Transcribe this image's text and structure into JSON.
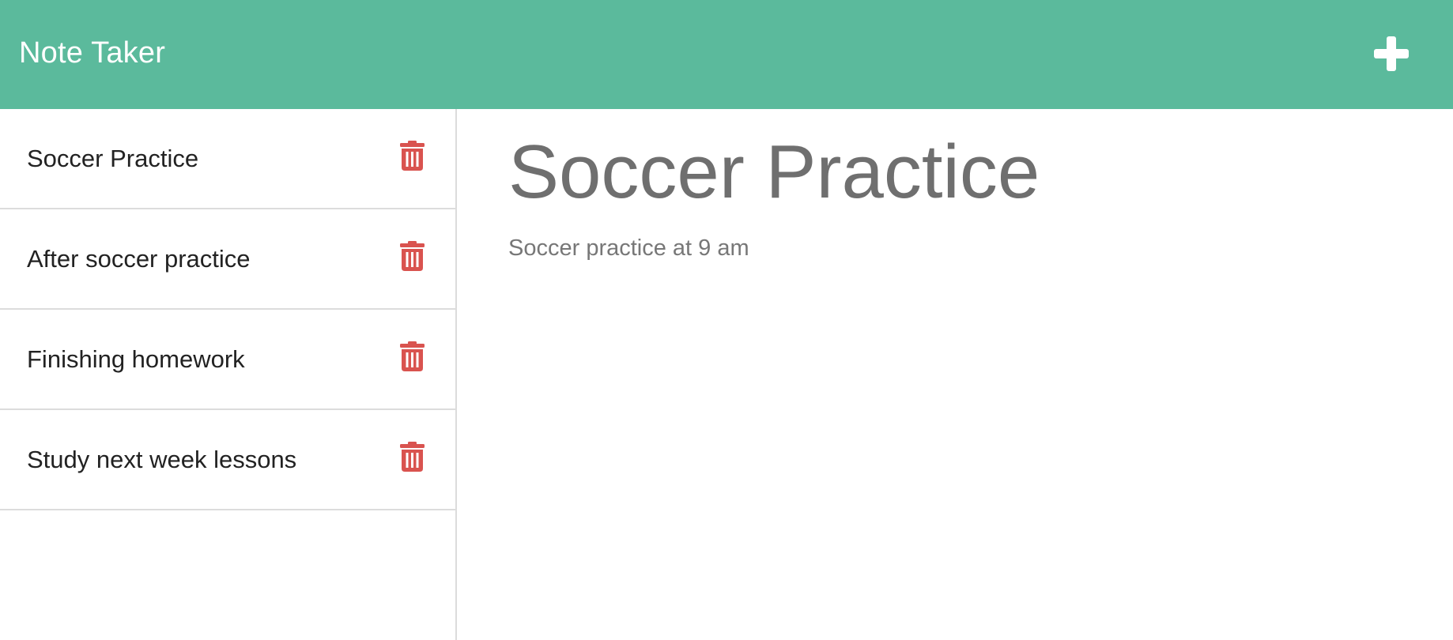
{
  "header": {
    "title": "Note Taker",
    "new_note_icon": "plus-icon"
  },
  "notes": [
    {
      "title": "Soccer Practice",
      "delete_icon": "trash-icon"
    },
    {
      "title": "After soccer practice",
      "delete_icon": "trash-icon"
    },
    {
      "title": "Finishing homework",
      "delete_icon": "trash-icon"
    },
    {
      "title": "Study next week lessons",
      "delete_icon": "trash-icon"
    }
  ],
  "active_note": {
    "title": "Soccer Practice",
    "text": "Soccer practice at 9 am"
  },
  "colors": {
    "header_background": "#5bba9c",
    "delete_icon": "#d9534f",
    "note_heading": "#6f6f6f"
  }
}
